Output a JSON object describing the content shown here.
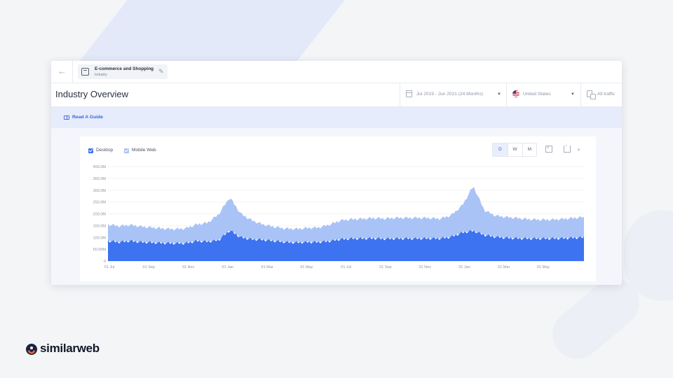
{
  "header": {
    "industry_title": "E-commerce and Shopping",
    "industry_subtitle": "Industry"
  },
  "page": {
    "title": "Industry Overview"
  },
  "filters": {
    "date_range": "Jul 2019 - Jun 2021 (24 Months)",
    "country": "United States",
    "traffic": "All traffic"
  },
  "guide": {
    "label": "Read A Guide"
  },
  "legend": {
    "desktop": "Desktop",
    "mobile": "Mobile Web"
  },
  "granularity": {
    "daily": "D",
    "weekly": "W",
    "monthly": "M",
    "selected": "D"
  },
  "brand": {
    "name": "similarweb"
  },
  "colors": {
    "desktop": "#3d73f0",
    "mobile": "#a9c3f7",
    "accent": "#3a64d8",
    "brand_orange": "#f26a2e",
    "brand_navy": "#1b2341"
  },
  "chart_data": {
    "type": "area",
    "stacked": true,
    "y_ticks": [
      "400.0M",
      "350.0M",
      "300.0M",
      "250.0M",
      "200.0M",
      "150.0M",
      "100.0M",
      "50.00M",
      "0"
    ],
    "ylim": [
      0,
      400
    ],
    "x_ticks": [
      "01 Jul",
      "01 Sep",
      "01 Nov",
      "01 Jan",
      "01 Mar",
      "01 May",
      "01 Jul",
      "01 Sep",
      "01 Nov",
      "01 Jan",
      "01 Mar",
      "01 May"
    ],
    "grid": true,
    "legend_position": "top-left",
    "series": [
      {
        "name": "Desktop",
        "approx_values_M": [
          85,
          80,
          85,
          80,
          78,
          76,
          75,
          75,
          85,
          82,
          88,
          130,
          100,
          92,
          90,
          85,
          80,
          78,
          80,
          80,
          84,
          92,
          95,
          95,
          96,
          94,
          95,
          95,
          95,
          96,
          95,
          102,
          120,
          128,
          110,
          102,
          98,
          96,
          95,
          95,
          95,
          96,
          98,
          100
        ]
      },
      {
        "name": "Mobile Web",
        "approx_values_M": [
          70,
          68,
          68,
          66,
          64,
          62,
          60,
          63,
          70,
          80,
          110,
          140,
          100,
          80,
          65,
          60,
          58,
          58,
          60,
          62,
          70,
          80,
          82,
          84,
          86,
          86,
          88,
          88,
          88,
          86,
          84,
          92,
          115,
          190,
          105,
          90,
          88,
          86,
          82,
          80,
          80,
          82,
          84,
          86
        ]
      }
    ]
  }
}
